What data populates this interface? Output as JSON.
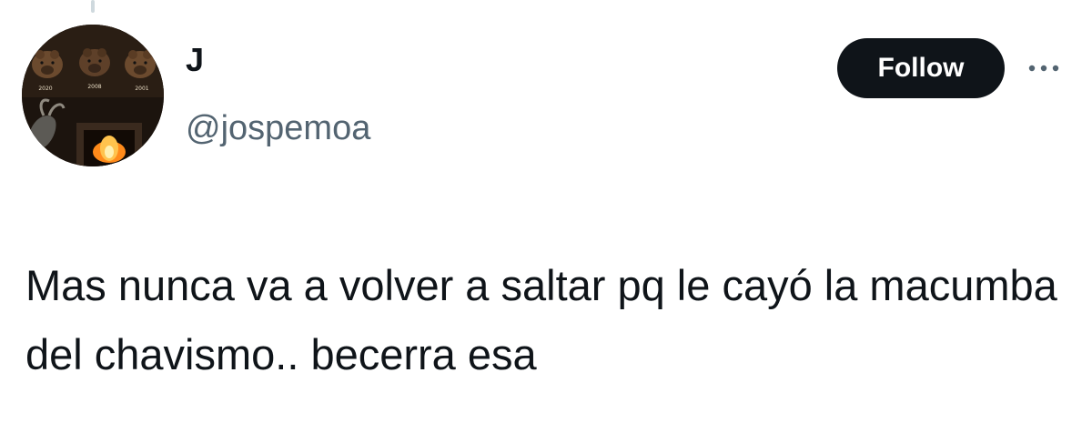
{
  "tweet": {
    "author": {
      "display_name": "J",
      "handle": "@jospemoa",
      "avatar": {
        "description_icon": "mounted-trophies-fireplace-avatar",
        "plaque_labels": [
          "2020",
          "2008",
          "2001"
        ]
      }
    },
    "follow_label": "Follow",
    "more_icon": "more-horizontal-icon",
    "text": "Mas nunca va a volver a saltar pq le cayó la macumba del chavismo.. becerra esa"
  },
  "colors": {
    "text_primary": "#0f1419",
    "text_secondary": "#536471",
    "button_bg": "#0f1419",
    "button_text": "#ffffff",
    "thread_line": "#cfd9de"
  }
}
